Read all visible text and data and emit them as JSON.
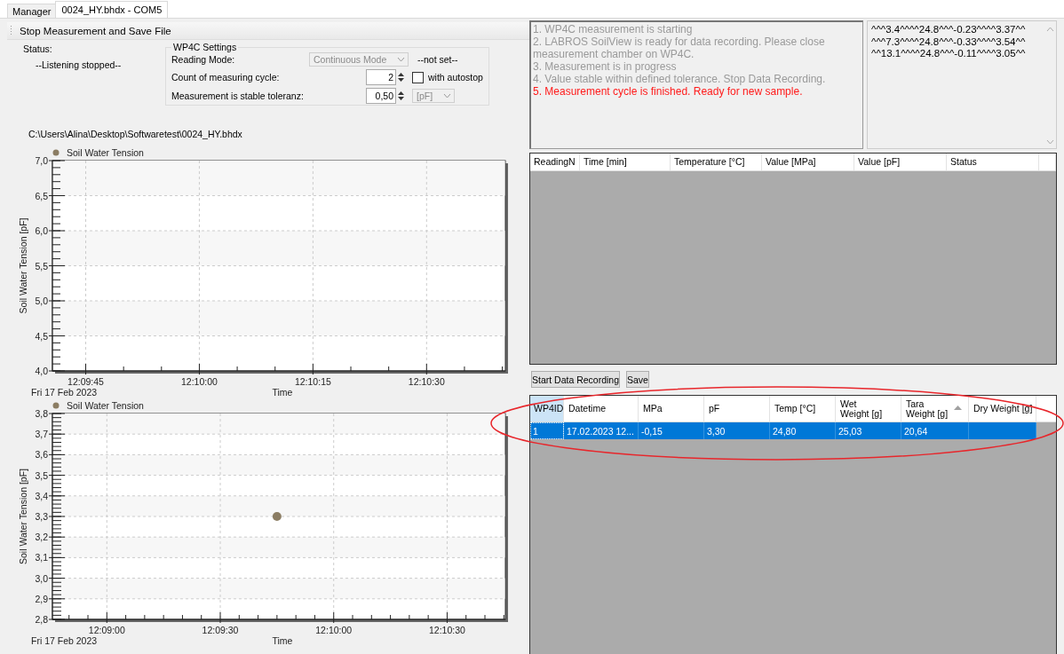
{
  "tabs": [
    {
      "label": "Manager",
      "selected": false
    },
    {
      "label": "0024_HY.bhdx - COM5",
      "selected": true
    }
  ],
  "toolbar": {
    "button": "Stop Measurement and Save File"
  },
  "status": {
    "label": "Status:",
    "value": "--Listening stopped--"
  },
  "settings": {
    "title": "WP4C Settings",
    "reading_mode": {
      "label": "Reading Mode:",
      "value": "Continuous Mode",
      "disabled": true,
      "note": "--not set--"
    },
    "count": {
      "label": "Count of measuring cycle:",
      "value": "2"
    },
    "autostop": {
      "label": "with autostop",
      "checked": false
    },
    "tolerance": {
      "label": "Measurement is stable toleranz:",
      "value": "0,50"
    },
    "unit": {
      "value": "[pF]",
      "disabled": true
    }
  },
  "file_path": "C:\\Users\\Alina\\Desktop\\Softwaretest\\0024_HY.bhdx",
  "charts": [
    {
      "date_label": "Fri 17  Feb 2023",
      "chart_data": {
        "type": "scatter",
        "xlabel": "Time",
        "ylabel": "Soil Water Tension [pF]",
        "grid": true,
        "categories": [
          "12:09:45",
          null,
          null,
          "12:10:00",
          null,
          null,
          "12:10:15",
          null,
          null,
          "12:10:30",
          null,
          null
        ],
        "series": [
          {
            "name": "Soil Water Tension",
            "color": "#8b7d63",
            "values": [
              null,
              null,
              null,
              null,
              null,
              null,
              null,
              null,
              null,
              null,
              null,
              null
            ]
          }
        ],
        "ylim": [
          4.0,
          7.0
        ],
        "yticks": [
          {
            "value": 4.0,
            "label": "4,0"
          },
          {
            "value": 4.5,
            "label": "4,5"
          },
          {
            "value": 5.0,
            "label": "5,0"
          },
          {
            "value": 5.5,
            "label": "5,5"
          },
          {
            "value": 6.0,
            "label": "6,0"
          },
          {
            "value": 6.5,
            "label": "6,5"
          },
          {
            "value": 7.0,
            "label": "7,0"
          }
        ]
      }
    },
    {
      "date_label": "Fri 17  Feb 2023",
      "chart_data": {
        "type": "scatter",
        "xlabel": "Time",
        "ylabel": "Soil Water Tension [pF]",
        "grid": true,
        "categories": [
          null,
          null,
          "12:09:00",
          null,
          null,
          null,
          null,
          null,
          "12:09:30",
          null,
          null,
          null,
          null,
          null,
          "12:10:00",
          null,
          null,
          null,
          null,
          null,
          "12:10:30",
          null,
          null,
          null
        ],
        "series": [
          {
            "name": "Soil Water Tension",
            "color": "#8b7d63",
            "values": [
              null,
              null,
              null,
              null,
              null,
              null,
              null,
              null,
              null,
              null,
              null,
              3.3,
              null,
              null,
              null,
              null,
              null,
              null,
              null,
              null,
              null,
              null,
              null,
              null
            ]
          }
        ],
        "ylim": [
          2.8,
          3.8
        ],
        "yticks": [
          {
            "value": 2.8,
            "label": "2,8"
          },
          {
            "value": 2.9,
            "label": "2,9"
          },
          {
            "value": 3.0,
            "label": "3,0"
          },
          {
            "value": 3.1,
            "label": "3,1"
          },
          {
            "value": 3.2,
            "label": "3,2"
          },
          {
            "value": 3.3,
            "label": "3,3"
          },
          {
            "value": 3.4,
            "label": "3,4"
          },
          {
            "value": 3.5,
            "label": "3,5"
          },
          {
            "value": 3.6,
            "label": "3,6"
          },
          {
            "value": 3.7,
            "label": "3,7"
          },
          {
            "value": 3.8,
            "label": "3,8"
          }
        ]
      }
    }
  ],
  "messages": [
    {
      "text": "1. WP4C measurement is starting",
      "active": false
    },
    {
      "text": "2. LABROS SoilView is ready for data recording. Please close measurement chamber on WP4C.",
      "active": false
    },
    {
      "text": "3. Measurement is in progress",
      "active": false
    },
    {
      "text": "4. Value stable within defined tolerance. Stop Data Recording.",
      "active": false
    },
    {
      "text": "5. Measurement cycle is finished. Ready for new sample.",
      "active": true
    }
  ],
  "raw_data": [
    "^^^3.4^^^^24.8^^^-0.23^^^^3.37^^",
    "^^^7.3^^^^24.8^^^-0.33^^^^3.54^^",
    "^^13.1^^^^24.8^^^-0.11^^^^3.05^^"
  ],
  "readings_table": {
    "columns": [
      "ReadingN",
      "Time [min]",
      "Temperature [°C]",
      "Value [MPa]",
      "Value [pF]",
      "Status"
    ]
  },
  "buttons": [
    "Start Data Recording",
    "Save"
  ],
  "results_table": {
    "columns": [
      {
        "label": "WP4ID",
        "selected": true,
        "sorted": false
      },
      {
        "label": "Datetime",
        "selected": false,
        "sorted": false
      },
      {
        "label": "MPa",
        "selected": false,
        "sorted": false
      },
      {
        "label": "pF",
        "selected": false,
        "sorted": false
      },
      {
        "label": "Temp [°C]",
        "selected": false,
        "sorted": false
      },
      {
        "label": "Wet Weight [g]",
        "selected": false,
        "sorted": false
      },
      {
        "label": "Tara Weight [g]",
        "selected": false,
        "sorted": true
      },
      {
        "label": "Dry Weight [g]",
        "selected": false,
        "sorted": false
      }
    ],
    "rows": [
      {
        "selected": true,
        "cells": [
          "1",
          "17.02.2023 12...",
          "-0,15",
          "3,30",
          "24,80",
          "25,03",
          "20,64"
        ]
      }
    ]
  },
  "annotation": {
    "kind": "ellipse",
    "color": "#e8262b"
  }
}
